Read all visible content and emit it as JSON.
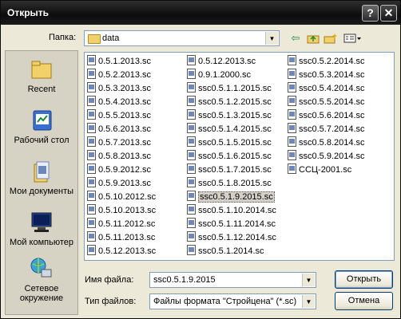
{
  "window": {
    "title": "Открыть",
    "help_glyph": "?",
    "close_glyph": "✕"
  },
  "look_in": {
    "label": "Папка:",
    "value": "data"
  },
  "places": [
    {
      "label": "Recent",
      "icon": "recent-folder-icon"
    },
    {
      "label": "Рабочий стол",
      "icon": "desktop-icon"
    },
    {
      "label": "Мои документы",
      "icon": "my-documents-icon"
    },
    {
      "label": "Мой компьютер",
      "icon": "my-computer-icon"
    },
    {
      "label": "Сетевое окружение",
      "icon": "network-icon"
    }
  ],
  "files": [
    [
      "0.5.1.2013.sc",
      "0.5.2.2013.sc",
      "0.5.3.2013.sc",
      "0.5.4.2013.sc",
      "0.5.5.2013.sc",
      "0.5.6.2013.sc",
      "0.5.7.2013.sc",
      "0.5.8.2013.sc",
      "0.5.9.2012.sc",
      "0.5.9.2013.sc",
      "0.5.10.2012.sc",
      "0.5.10.2013.sc",
      "0.5.11.2012.sc",
      "0.5.11.2013.sc",
      "0.5.12.2013.sc"
    ],
    [
      "0.5.12.2013.sc",
      "0.9.1.2000.sc",
      "ssc0.5.1.1.2015.sc",
      "ssc0.5.1.2.2015.sc",
      "ssc0.5.1.3.2015.sc",
      "ssc0.5.1.4.2015.sc",
      "ssc0.5.1.5.2015.sc",
      "ssc0.5.1.6.2015.sc",
      "ssc0.5.1.7.2015.sc",
      "ssc0.5.1.8.2015.sc",
      "ssc0.5.1.9.2015.sc",
      "ssc0.5.1.10.2014.sc",
      "ssc0.5.1.11.2014.sc",
      "ssc0.5.1.12.2014.sc",
      "ssc0.5.1.2014.sc"
    ],
    [
      "ssc0.5.2.2014.sc",
      "ssc0.5.3.2014.sc",
      "ssc0.5.4.2014.sc",
      "ssc0.5.5.2014.sc",
      "ssc0.5.6.2014.sc",
      "ssc0.5.7.2014.sc",
      "ssc0.5.8.2014.sc",
      "ssc0.5.9.2014.sc",
      "ССЦ-2001.sc"
    ]
  ],
  "selected_file": "ssc0.5.1.9.2015.sc",
  "filename": {
    "label": "Имя файла:",
    "value": "ssc0.5.1.9.2015"
  },
  "filetype": {
    "label": "Тип файлов:",
    "value": "Файлы формата \"Стройцена\" (*.sc)"
  },
  "buttons": {
    "open": "Открыть",
    "cancel": "Отмена"
  }
}
